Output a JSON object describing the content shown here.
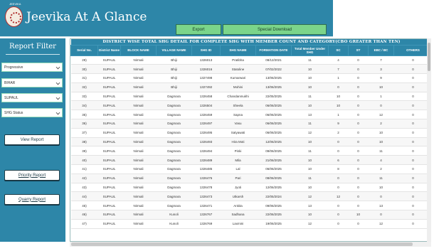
{
  "header": {
    "logo_caption": "JEEVIKA",
    "title": "Jeevika At A Glance",
    "export_label": "Export",
    "special_download_label": "Special Download"
  },
  "sidebar": {
    "title": "Report Filter",
    "filters": [
      "Progressive",
      "BIHAR",
      "SUPAUL",
      "SHG Status"
    ],
    "view_report_label": "View Report",
    "priority_report_label": "Priority Report",
    "quarry_report_label": "Quarry Report"
  },
  "table": {
    "caption": "DISTRICT WISE TOTAL  SHG DETAIL FOR COMPLETE SHG WITH MEMBER COUNT AND CATEGORY(CBO GREATER THAN TEN)",
    "columns": [
      "Serial No.",
      "District Name",
      "BLOCK NAME",
      "VILLAGE NAME",
      "SHG ID",
      "SHG NAME",
      "FORMATION DATE",
      "Total Member Under SHG",
      "SC",
      "ST",
      "EBC / BC",
      "OTHERS"
    ],
    "rows": [
      [
        "29)",
        "SUPAUL",
        "Nirmali",
        "Bhiji",
        "1326013",
        "Pratibha",
        "08/12/2021",
        "11",
        "4",
        "0",
        "7",
        "0"
      ],
      [
        "30)",
        "SUPAUL",
        "Nirmali",
        "Bhiji",
        "1326016",
        "Statoline",
        "07/02/2022",
        "10",
        "7",
        "0",
        "3",
        "0"
      ],
      [
        "31)",
        "SUPAUL",
        "Nirmali",
        "Bhiji",
        "1327498",
        "Kumarwari",
        "13/06/2025",
        "10",
        "1",
        "0",
        "9",
        "0"
      ],
      [
        "32)",
        "SUPAUL",
        "Nirmali",
        "Bhiji",
        "1327492",
        "Mohini",
        "13/06/2025",
        "10",
        "0",
        "0",
        "10",
        "0"
      ],
      [
        "33)",
        "SUPAUL",
        "Nirmali",
        "Dagmara",
        "1326458",
        "Chandanmukhi",
        "22/05/2025",
        "11",
        "10",
        "0",
        "1",
        "0"
      ],
      [
        "34)",
        "SUPAUL",
        "Nirmali",
        "Dagmara",
        "1326504",
        "Sheela",
        "06/06/2025",
        "10",
        "10",
        "0",
        "0",
        "0"
      ],
      [
        "35)",
        "SUPAUL",
        "Nirmali",
        "Dagmara",
        "1326459",
        "Sapna",
        "06/06/2025",
        "13",
        "1",
        "0",
        "12",
        "0"
      ],
      [
        "36)",
        "SUPAUL",
        "Nirmali",
        "Dagmara",
        "1326497",
        "Vasu",
        "06/06/2025",
        "11",
        "9",
        "0",
        "2",
        "0"
      ],
      [
        "37)",
        "SUPAUL",
        "Nirmali",
        "Dagmara",
        "1326495",
        "Satyawati",
        "06/06/2025",
        "12",
        "2",
        "0",
        "10",
        "0"
      ],
      [
        "38)",
        "SUPAUL",
        "Nirmali",
        "Dagmara",
        "1326493",
        "Hira Moti",
        "12/06/2025",
        "10",
        "0",
        "0",
        "10",
        "0"
      ],
      [
        "39)",
        "SUPAUL",
        "Nirmali",
        "Dagmara",
        "1326494",
        "Pinki",
        "09/06/2025",
        "11",
        "0",
        "0",
        "11",
        "0"
      ],
      [
        "40)",
        "SUPAUL",
        "Nirmali",
        "Dagmara",
        "1326489",
        "Mila",
        "21/06/2025",
        "10",
        "6",
        "0",
        "4",
        "0"
      ],
      [
        "41)",
        "SUPAUL",
        "Nirmali",
        "Dagmara",
        "1326485",
        "Lal",
        "06/06/2025",
        "10",
        "8",
        "0",
        "2",
        "0"
      ],
      [
        "42)",
        "SUPAUL",
        "Nirmali",
        "Dagmara",
        "1326476",
        "Pari",
        "08/06/2025",
        "11",
        "0",
        "0",
        "11",
        "0"
      ],
      [
        "43)",
        "SUPAUL",
        "Nirmali",
        "Dagmara",
        "1326478",
        "Jyoti",
        "12/06/2025",
        "10",
        "0",
        "0",
        "10",
        "0"
      ],
      [
        "44)",
        "SUPAUL",
        "Nirmali",
        "Dagmara",
        "1326473",
        "Utkarsh",
        "22/05/2024",
        "12",
        "12",
        "0",
        "0",
        "0"
      ],
      [
        "45)",
        "SUPAUL",
        "Nirmali",
        "Dagmara",
        "1326471",
        "Ankita",
        "09/06/2025",
        "13",
        "0",
        "0",
        "13",
        "0"
      ],
      [
        "46)",
        "SUPAUL",
        "Nirmali",
        "Kunoli",
        "1326767",
        "Sadhana",
        "22/06/2025",
        "10",
        "0",
        "10",
        "0",
        "0"
      ],
      [
        "47)",
        "SUPAUL",
        "Nirmali",
        "Kunoli",
        "1326769",
        "Laxmini",
        "19/06/2025",
        "12",
        "0",
        "0",
        "12",
        "0"
      ]
    ]
  }
}
